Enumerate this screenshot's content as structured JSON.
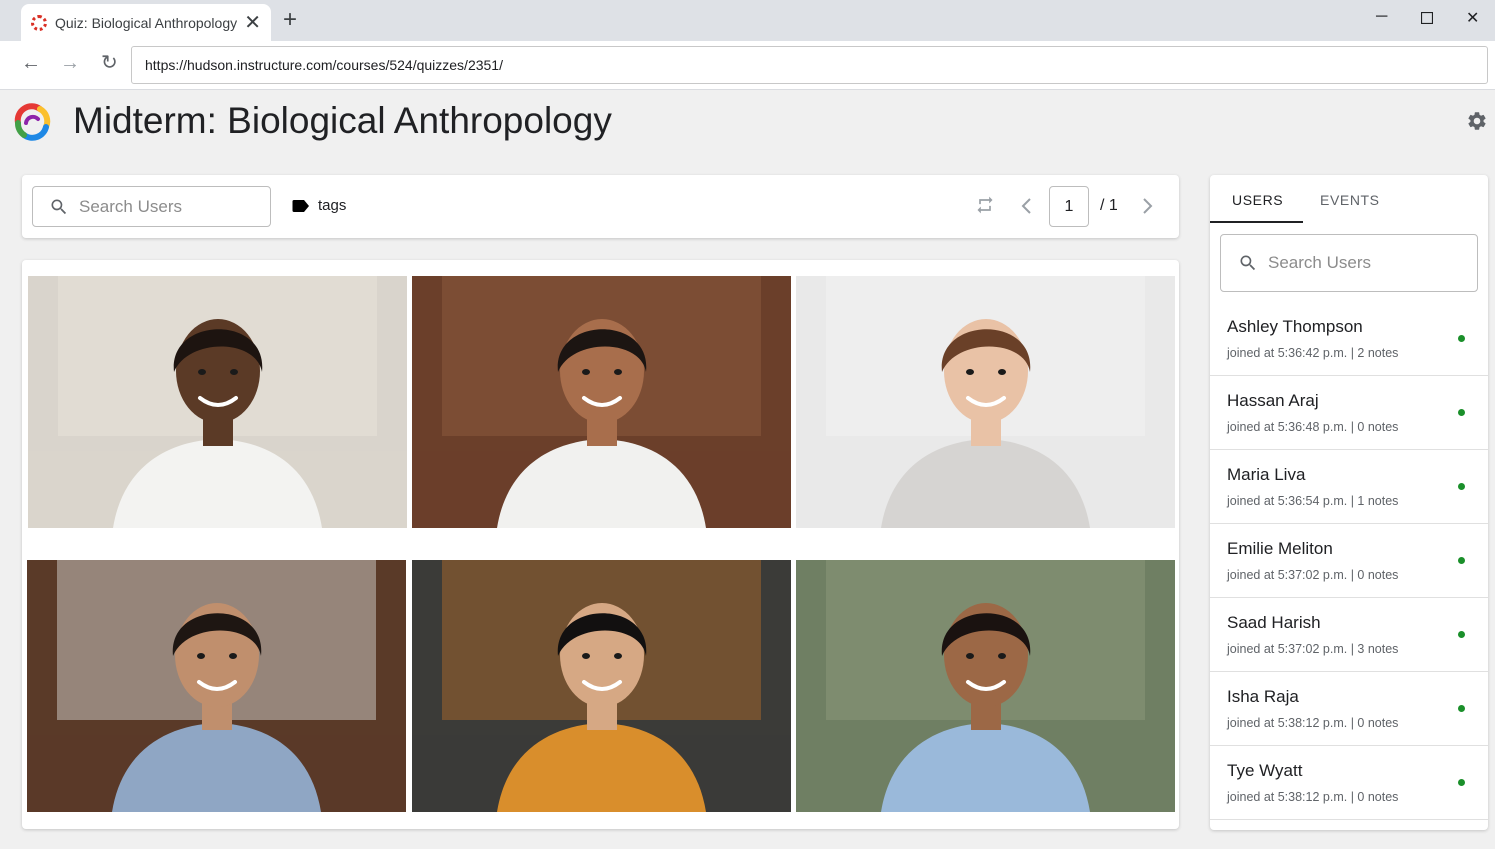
{
  "browser": {
    "tab_title": "Quiz: Biological Anthropology",
    "url": "https://hudson.instructure.com/courses/524/quizzes/2351/"
  },
  "app": {
    "title": "Midterm: Biological Anthropology"
  },
  "filterbar": {
    "search_placeholder": "Search Users",
    "tags_label": "tags",
    "page_current": "1",
    "page_total": "/ 1"
  },
  "panel": {
    "tabs": [
      {
        "label": "USERS",
        "active": true
      },
      {
        "label": "EVENTS",
        "active": false
      }
    ],
    "search_placeholder": "Search Users",
    "users": [
      {
        "name": "Ashley Thompson",
        "meta": "joined at 5:36:42 p.m.  |  2 notes",
        "status": "online"
      },
      {
        "name": "Hassan Araj",
        "meta": "joined at 5:36:48 p.m.  |  0 notes",
        "status": "online"
      },
      {
        "name": "Maria Liva",
        "meta": "joined at 5:36:54 p.m.  |  1 notes",
        "status": "online"
      },
      {
        "name": "Emilie Meliton",
        "meta": "joined at 5:37:02 p.m.  |  0 notes",
        "status": "online"
      },
      {
        "name": "Saad Harish",
        "meta": "joined at 5:37:02 p.m.  |  3 notes",
        "status": "online"
      },
      {
        "name": "Isha Raja",
        "meta": "joined at 5:38:12 p.m.  |  0 notes",
        "status": "online"
      },
      {
        "name": "Tye Wyatt",
        "meta": "joined at 5:38:12 p.m.  |  0 notes",
        "status": "online"
      }
    ]
  },
  "video_tiles": [
    {
      "icon": "webcam-video",
      "bg": "#d9d4cc",
      "wall": "#e7e2d9",
      "skin": "#5b3a26",
      "hair": "#1d1410",
      "shirt": "#f3f3f1"
    },
    {
      "icon": "webcam-video",
      "bg": "#6b3f2a",
      "wall": "#8a5a3c",
      "skin": "#a86e4c",
      "hair": "#1c1512",
      "shirt": "#f1f1ef"
    },
    {
      "icon": "webcam-video",
      "bg": "#e9e9e9",
      "wall": "#f2f2f2",
      "skin": "#e9c2a6",
      "hair": "#6a4028",
      "shirt": "#d6d4d2"
    },
    {
      "icon": "webcam-video",
      "bg": "#5a3a28",
      "wall": "#c9c3bd",
      "skin": "#c08f6d",
      "hair": "#1e1612",
      "shirt": "#8fa6c4"
    },
    {
      "icon": "webcam-video",
      "bg": "#3b3b38",
      "wall": "#a0642c",
      "skin": "#d6a884",
      "hair": "#121010",
      "shirt": "#d98e2c"
    },
    {
      "icon": "webcam-video",
      "bg": "#6f7f63",
      "wall": "#8a987a",
      "skin": "#9c6846",
      "hair": "#1a1210",
      "shirt": "#9ab9da"
    }
  ],
  "colors": {
    "online_status": "#1a8f2a",
    "tab_indicator": "#202124"
  }
}
